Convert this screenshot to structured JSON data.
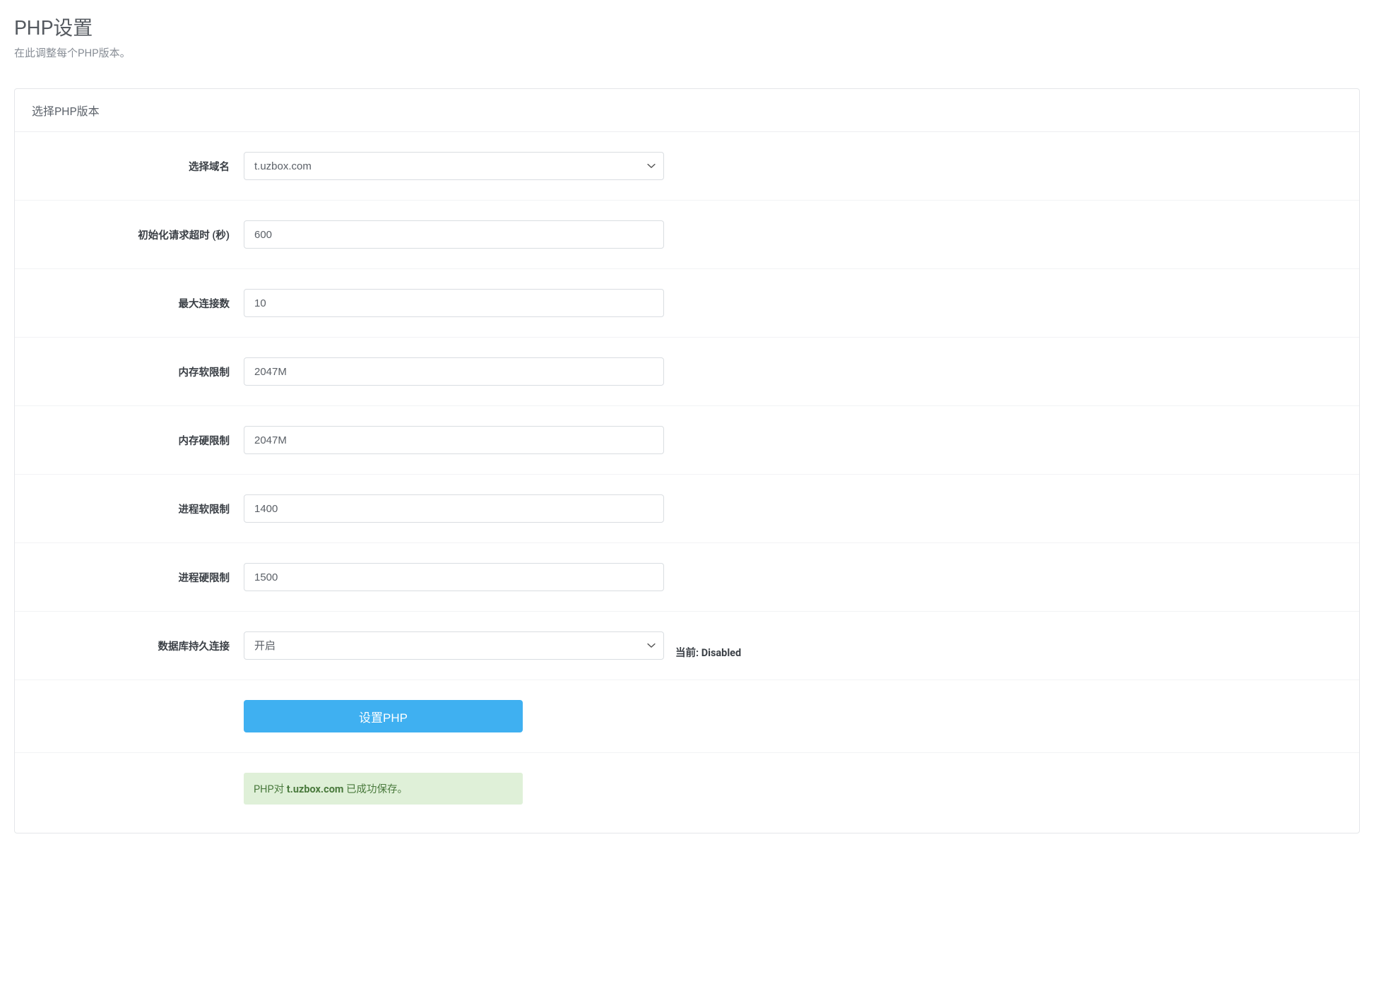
{
  "header": {
    "title": "PHP设置",
    "subtitle": "在此调整每个PHP版本。"
  },
  "panel": {
    "title": "选择PHP版本"
  },
  "form": {
    "domain": {
      "label": "选择域名",
      "value": "t.uzbox.com"
    },
    "init_timeout": {
      "label": "初始化请求超时 (秒)",
      "value": "600"
    },
    "max_connections": {
      "label": "最大连接数",
      "value": "10"
    },
    "memory_soft": {
      "label": "内存软限制",
      "value": "2047M"
    },
    "memory_hard": {
      "label": "内存硬限制",
      "value": "2047M"
    },
    "process_soft": {
      "label": "进程软限制",
      "value": "1400"
    },
    "process_hard": {
      "label": "进程硬限制",
      "value": "1500"
    },
    "persistent": {
      "label": "数据库持久连接",
      "value": "开启",
      "helper": "当前: Disabled"
    },
    "submit_label": "设置PHP"
  },
  "alert": {
    "prefix": "PHP对 ",
    "domain": "t.uzbox.com",
    "suffix": " 已成功保存。"
  }
}
